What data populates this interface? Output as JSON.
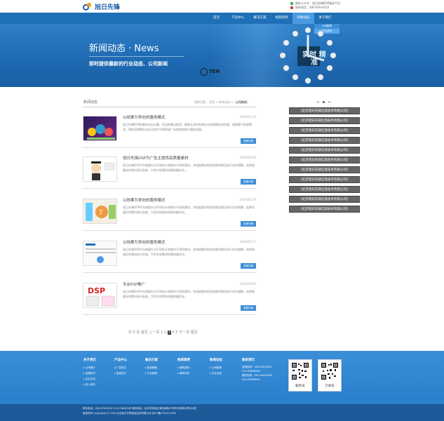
{
  "header": {
    "logo_text": "旭日先锋",
    "contact_lines": [
      "微信公众号：旭日先锋DSP服务平台",
      "联系电话：400-876-8510"
    ]
  },
  "nav": {
    "items": [
      "首页",
      "产品中心",
      "解决方案",
      "经典案例",
      "新闻动态",
      "关于我们"
    ],
    "active_index": 4,
    "dropdown": [
      "公司新闻",
      "行业资讯"
    ]
  },
  "banner": {
    "title": "新闻动态 · News",
    "subtitle": "即时提供最新的行业动态、公司新闻",
    "brand": "TEN",
    "clock_word": "实时 精准"
  },
  "section": {
    "title": "新闻动态",
    "breadcrumb_prefix": "您的位置： 首页 > 新闻动态 > ",
    "breadcrumb_current": "公司新闻"
  },
  "news": [
    {
      "title": "以效果为导向的服务模式",
      "date": "2016/01/13",
      "desc": "旭日先锋DSP依靠先进云计算、优化的算法推荐，精准无误的系统后台投放服务和资源，根据客户投放需求，帮助品牌商在适应过程中不断提高广告投放效果与服务质量。",
      "more": "查看详情"
    },
    {
      "title": "旭日先锋DSP为广告主提供高质量素材",
      "date": "2016/01/09",
      "desc": "旭日先锋DSP平台根据针对不同的计划制作不同的素材，并依据素材的投放使用情况进行实时调整，选择质量好的素材进行投放，力争实现素材质量的最优化。",
      "more": "查看详情"
    },
    {
      "title": "以效果为导向的服务模式",
      "date": "2016/01/29",
      "desc": "旭日先锋DSP平台根据针对不同的计划制作不同的素材，并依据素材的投放使用情况进行实时调整，选择质量好的素材进行投放，力争实现素材质量的最优化。",
      "more": "查看详情"
    },
    {
      "title": "以效果为导向的服务模式",
      "date": "2016/01/17",
      "desc": "旭日先锋DSP平台根据针对不同的计划制作不同的素材，并依据素材的投放使用情况进行实时调整，选择质量好的素材进行投放，力争实现素材质量的最优化。",
      "more": "查看详情"
    },
    {
      "title": "专业P2P推广",
      "date": "2016/01/04",
      "desc": "旭日先锋DSP平台根据针对不同的计划制作不同的素材，并依据素材的投放使用情况进行实时调整，选择质量好的素材进行投放，力争实现素材质量的最优化。",
      "more": "查看详情"
    }
  ],
  "sidebar": {
    "links": [
      "《北京旭日先锋信息技术有限公司》",
      "《北京旭日先锋信息技术有限公司》",
      "《北京旭日先锋信息技术有限公司》",
      "《北京旭日先锋信息技术有限公司》",
      "《北京旭日先锋信息技术有限公司》",
      "《北京旭日先锋信息技术有限公司》",
      "《北京旭日先锋信息技术有限公司》",
      "《北京旭日先锋信息技术有限公司》",
      "《北京旭日先锋信息技术有限公司》",
      "《北京旭日先锋信息技术有限公司》",
      "《北京旭日先锋信息技术有限公司》"
    ]
  },
  "pager": {
    "summary": "共 5 页 首页 上一页 ",
    "pages": [
      "1",
      "2",
      "3",
      "4",
      "5"
    ],
    "current": "3",
    "tail": " 下一页 尾页"
  },
  "footer": {
    "columns": [
      {
        "heading": "关于我们",
        "links": [
          "公司简介",
          "发展历史",
          "企业文化",
          "加入我们"
        ]
      },
      {
        "heading": "产品中心",
        "links": [
          "广告形式",
          "投放形式"
        ]
      },
      {
        "heading": "解决方案",
        "links": [
          "投放策略",
          "行业案例"
        ]
      },
      {
        "heading": "经典案例",
        "links": [
          "案例说明",
          "案例分析"
        ]
      },
      {
        "heading": "新闻动态",
        "links": [
          "公司新闻",
          "行业动态"
        ]
      },
      {
        "heading": "联系我们",
        "links": [
          "咨询热线：400-876-8510",
          "010-53806006",
          "服务热线：010-59425282",
          "010-53806004"
        ]
      }
    ],
    "qr_captions": [
      "服务号",
      "订阅号"
    ],
    "copyright_lines": [
      "联系电话：400-876-8510  010-53806006    通讯地址：北京市海淀区海淀南路19号时代网络大厦406室",
      "版权所有 Copyright(C) 2016 北京旭日先锋信息技术有限公司 京ICP备15010101号"
    ]
  },
  "colors": {
    "brand": "#1e6fb5",
    "accent": "#3f8fd6",
    "sidebar": "#666666"
  }
}
